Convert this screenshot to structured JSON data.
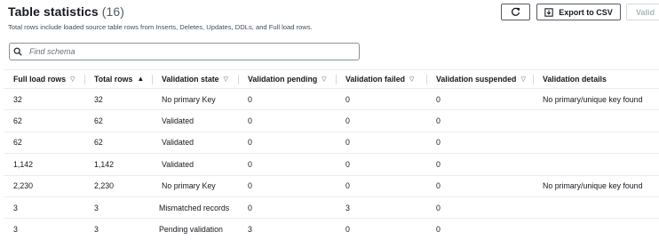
{
  "header": {
    "title": "Table statistics",
    "count": "(16)",
    "subtitle": "Total rows include loaded source table rows from Inserts, Deletes, Updates, DDLs, and Full load rows."
  },
  "toolbar": {
    "refresh_icon": "refresh-icon",
    "export_icon": "export-icon",
    "export_label": "Export to CSV",
    "validate_label": "Valid"
  },
  "search": {
    "placeholder": "Find schema",
    "value": "",
    "icon": "search-icon"
  },
  "table": {
    "columns": [
      {
        "label": "Full load rows",
        "sort": "none"
      },
      {
        "label": "Total rows",
        "sort": "asc"
      },
      {
        "label": "Validation state",
        "sort": "none"
      },
      {
        "label": "Validation pending",
        "sort": "none"
      },
      {
        "label": "Validation failed",
        "sort": "none"
      },
      {
        "label": "Validation suspended",
        "sort": "none"
      },
      {
        "label": "Validation details",
        "sort": ""
      }
    ],
    "rows": [
      [
        "32",
        "32",
        "No primary Key",
        "0",
        "0",
        "0",
        "No primary/unique key found"
      ],
      [
        "62",
        "62",
        "Validated",
        "0",
        "0",
        "0",
        ""
      ],
      [
        "62",
        "62",
        "Validated",
        "0",
        "0",
        "0",
        ""
      ],
      [
        "1,142",
        "1,142",
        "Validated",
        "0",
        "0",
        "0",
        ""
      ],
      [
        "2,230",
        "2,230",
        "No primary Key",
        "0",
        "0",
        "0",
        "No primary/unique key found"
      ],
      [
        "3",
        "3",
        "Mismatched records",
        "0",
        "3",
        "0",
        ""
      ],
      [
        "3",
        "3",
        "Pending validation",
        "3",
        "0",
        "0",
        ""
      ]
    ]
  },
  "colors": {
    "text": "#16191f",
    "border": "#545b64",
    "divider": "#eaeded"
  }
}
